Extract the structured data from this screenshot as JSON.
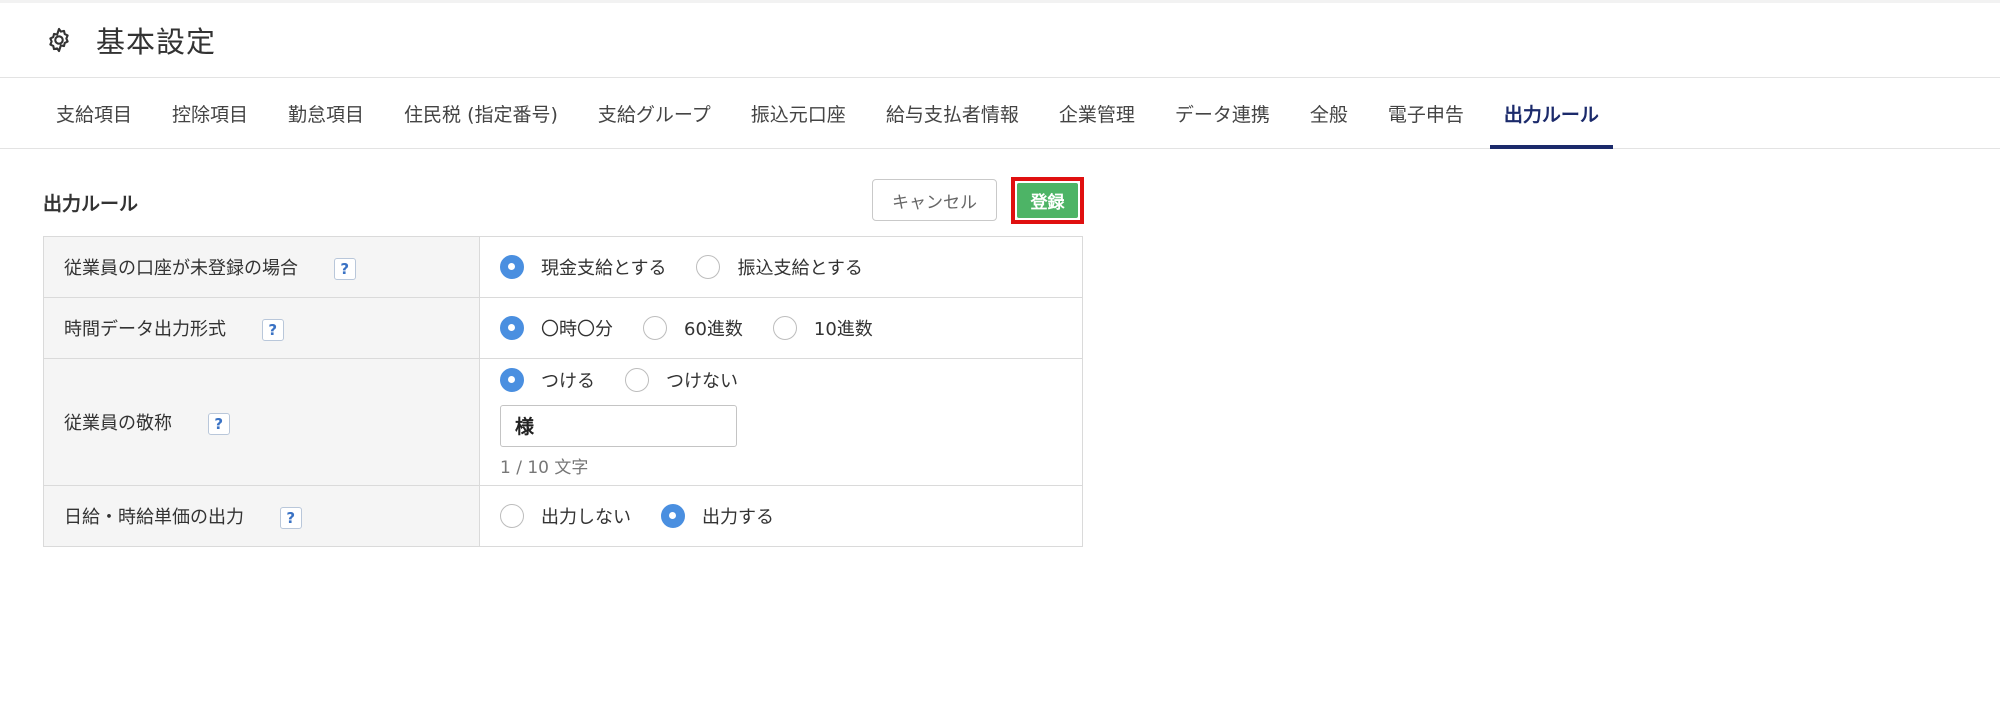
{
  "header": {
    "title": "基本設定",
    "icon": "gear-icon"
  },
  "tabs": [
    {
      "label": "支給項目",
      "active": false
    },
    {
      "label": "控除項目",
      "active": false
    },
    {
      "label": "勤怠項目",
      "active": false
    },
    {
      "label": "住民税 (指定番号)",
      "active": false
    },
    {
      "label": "支給グループ",
      "active": false
    },
    {
      "label": "振込元口座",
      "active": false
    },
    {
      "label": "給与支払者情報",
      "active": false
    },
    {
      "label": "企業管理",
      "active": false
    },
    {
      "label": "データ連携",
      "active": false
    },
    {
      "label": "全般",
      "active": false
    },
    {
      "label": "電子申告",
      "active": false
    },
    {
      "label": "出力ルール",
      "active": true
    }
  ],
  "section": {
    "title": "出力ルール",
    "cancel_label": "キャンセル",
    "register_label": "登録"
  },
  "rows": {
    "account": {
      "label": "従業員の口座が未登録の場合",
      "help": "?",
      "options": [
        "現金支給とする",
        "振込支給とする"
      ],
      "selected": "現金支給とする"
    },
    "time_format": {
      "label": "時間データ出力形式",
      "help": "?",
      "options": [
        "〇時〇分",
        "60進数",
        "10進数"
      ],
      "selected": "〇時〇分"
    },
    "honorific": {
      "label": "従業員の敬称",
      "help": "?",
      "options": [
        "つける",
        "つけない"
      ],
      "selected": "つける",
      "input_value": "様",
      "counter": "1 / 10 文字"
    },
    "daily_rate": {
      "label": "日給・時給単価の出力",
      "help": "?",
      "options": [
        "出力しない",
        "出力する"
      ],
      "selected": "出力する"
    }
  },
  "colors": {
    "accent": "#1b2a6b",
    "register_button": "#4db466",
    "highlight_border": "#e01010",
    "radio_selected": "#4a8fe0"
  }
}
